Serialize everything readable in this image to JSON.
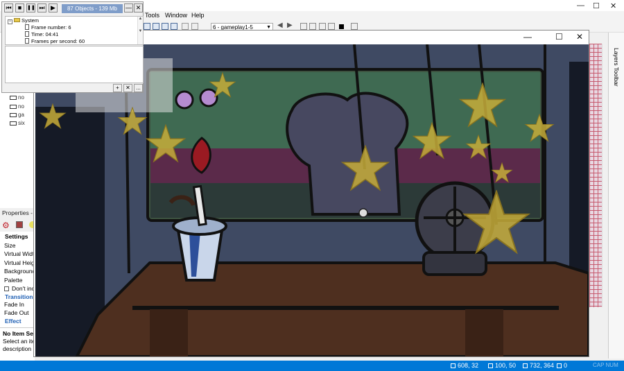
{
  "ide": {
    "menu": [
      "Tools",
      "Window",
      "Help"
    ],
    "frame_select": "6 - gameplay1-5",
    "window_controls": {
      "minimize": "—",
      "maximize": "☐",
      "close": "✕"
    }
  },
  "workspace_tree": [
    {
      "label": "no"
    },
    {
      "label": "no"
    },
    {
      "label": "ga"
    },
    {
      "label": "six"
    }
  ],
  "properties": {
    "title": "Properties -",
    "items": [
      {
        "label": "Settings",
        "kind": "bold"
      },
      {
        "label": "Size",
        "kind": "prop"
      },
      {
        "label": "Virtual Width",
        "kind": "prop"
      },
      {
        "label": "Virtual Height",
        "kind": "prop"
      },
      {
        "label": "Background",
        "kind": "prop"
      },
      {
        "label": "Palette",
        "kind": "prop"
      },
      {
        "label": "Don't include",
        "kind": "check"
      },
      {
        "label": "Transitions",
        "kind": "section"
      },
      {
        "label": "Fade In",
        "kind": "prop"
      },
      {
        "label": "Fade Out",
        "kind": "prop"
      },
      {
        "label": "Effect",
        "kind": "section"
      }
    ],
    "no_item_title": "No Item Selected",
    "no_item_desc_1": "Select an item to see its",
    "no_item_desc_2": "description"
  },
  "layers_toolbar": {
    "label": "Layers Toolbar"
  },
  "statusbar": {
    "coords1": "608, 32",
    "coords2": "100, 50",
    "coords3": "732, 364",
    "count": "0",
    "mode": "CAP  NUM"
  },
  "game_window": {
    "controls": {
      "minimize": "—",
      "maximize": "☐",
      "close": "✕"
    }
  },
  "debugger": {
    "status": "87 Objects - 139 Mb",
    "buttons": {
      "restart": "⏮",
      "stop": "■",
      "pause": "❚❚",
      "step": "⏭",
      "play": "▶",
      "minimize": "—",
      "close": "✕"
    },
    "tree": {
      "root": "System",
      "rows": [
        "Frame number: 6",
        "Time: 04:41",
        "Frames per second: 60"
      ]
    },
    "bottom_buttons": {
      "add": "+",
      "delete": "✕",
      "more": "..."
    }
  },
  "colors": {
    "status_blue": "#0078d7",
    "scene_bg": "#3f4a63",
    "star": "#c7ad3a",
    "table": "#4e2f1f"
  }
}
